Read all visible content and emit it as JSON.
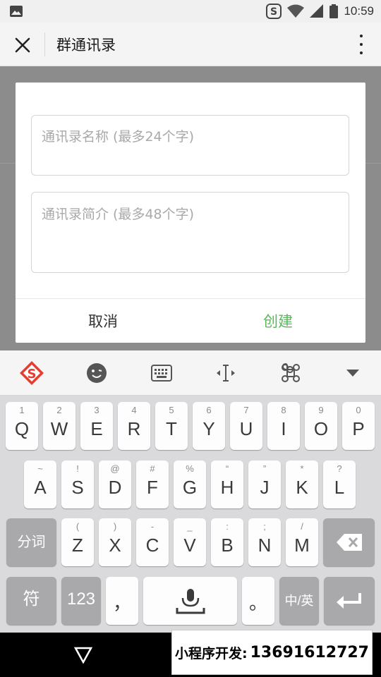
{
  "status_bar": {
    "time": "10:59",
    "icons": [
      "image-icon",
      "sogou-icon",
      "wifi-icon",
      "signal-icon",
      "battery-icon"
    ]
  },
  "header": {
    "title": "群通讯录",
    "close_icon": "close-icon",
    "menu_icon": "more-vert-icon"
  },
  "dialog": {
    "name_placeholder": "通讯录名称 (最多24个字)",
    "name_value": "",
    "intro_placeholder": "通讯录简介 (最多48个字)",
    "intro_value": "",
    "cancel_label": "取消",
    "create_label": "创建",
    "accent_color": "#58b85a"
  },
  "keyboard": {
    "toolbar_icons": [
      "sogou-logo-icon",
      "emoji-icon",
      "keyboard-icon",
      "cursor-icon",
      "command-icon",
      "collapse-icon"
    ],
    "row1": [
      {
        "hint": "1",
        "label": "Q"
      },
      {
        "hint": "2",
        "label": "W"
      },
      {
        "hint": "3",
        "label": "E"
      },
      {
        "hint": "4",
        "label": "R"
      },
      {
        "hint": "5",
        "label": "T"
      },
      {
        "hint": "6",
        "label": "Y"
      },
      {
        "hint": "7",
        "label": "U"
      },
      {
        "hint": "8",
        "label": "I"
      },
      {
        "hint": "9",
        "label": "O"
      },
      {
        "hint": "0",
        "label": "P"
      }
    ],
    "row2": [
      {
        "hint": "~",
        "label": "A"
      },
      {
        "hint": "!",
        "label": "S"
      },
      {
        "hint": "@",
        "label": "D"
      },
      {
        "hint": "#",
        "label": "F"
      },
      {
        "hint": "%",
        "label": "G"
      },
      {
        "hint": "“",
        "label": "H"
      },
      {
        "hint": "”",
        "label": "J"
      },
      {
        "hint": "*",
        "label": "K"
      },
      {
        "hint": "?",
        "label": "L"
      }
    ],
    "row3": [
      {
        "hint": "(",
        "label": "Z"
      },
      {
        "hint": ")",
        "label": "X"
      },
      {
        "hint": "-",
        "label": "C"
      },
      {
        "hint": "_",
        "label": "V"
      },
      {
        "hint": ":",
        "label": "B"
      },
      {
        "hint": ";",
        "label": "N"
      },
      {
        "hint": "/",
        "label": "M"
      }
    ],
    "segment_label": "分词",
    "symbol_label": "符",
    "number_label": "123",
    "comma_label": "，",
    "period_label": "。",
    "lang_label": "中/英",
    "backspace_icon": "backspace-icon",
    "enter_icon": "enter-icon",
    "mic_icon": "microphone-icon"
  },
  "nav_bar": {
    "back_icon": "back-triangle-icon"
  },
  "promo": {
    "label": "小程序开发:",
    "phone": "13691612727"
  }
}
